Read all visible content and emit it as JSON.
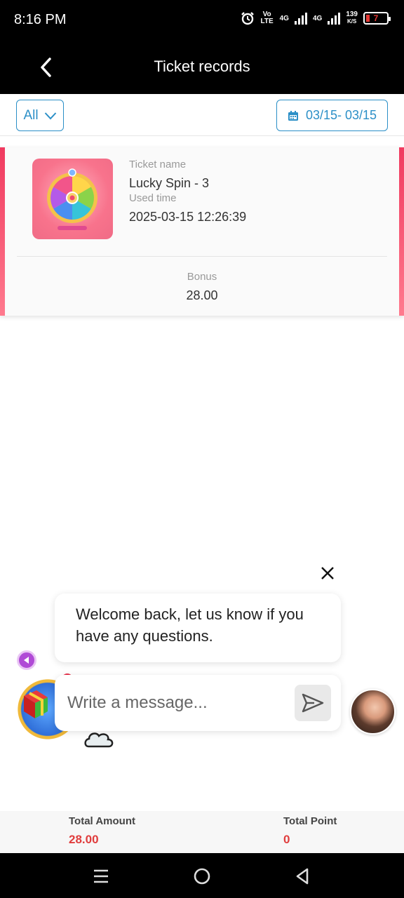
{
  "status_bar": {
    "time": "8:16 PM",
    "network_label": "Vo LTE",
    "signal_1": "4G",
    "signal_2": "4G",
    "speed_value": "139",
    "speed_unit": "K/S",
    "battery": "7"
  },
  "header": {
    "title": "Ticket records",
    "back_icon": "chevron-left-icon"
  },
  "filters": {
    "type_label": "All",
    "date_range": "03/15- 03/15",
    "calendar_icon": "calendar-icon"
  },
  "records": [
    {
      "ticket_name_label": "Ticket name",
      "ticket_name": "Lucky Spin - 3",
      "used_time_label": "Used time",
      "used_time": "2025-03-15 12:26:39",
      "bonus_label": "Bonus",
      "bonus": "28.00"
    }
  ],
  "chat": {
    "welcome_message": "Welcome back, let us know if you have any questions.",
    "input_placeholder": "Write a message...",
    "send_icon": "send-icon",
    "close_icon": "close-icon"
  },
  "footer": {
    "total_amount_label": "Total Amount",
    "total_amount": "28.00",
    "total_point_label": "Total Point",
    "total_point": "0"
  },
  "colors": {
    "accent": "#2b8fc7",
    "card_edge": "#f03a5f",
    "total_value": "#e03d3d"
  }
}
